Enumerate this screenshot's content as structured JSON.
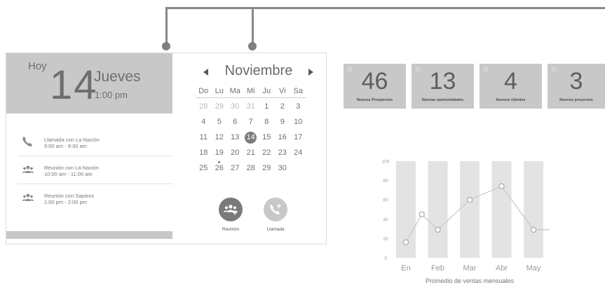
{
  "today": {
    "label": "Hoy",
    "day_number": "14",
    "weekday": "Jueves",
    "time": "1:00 pm"
  },
  "events": [
    {
      "icon": "phone-icon",
      "title": "Llamada con La Nación",
      "time": "9:00 am - 9:30 am"
    },
    {
      "icon": "people-icon",
      "title": "Reunión con La Nación",
      "time": "10:00 am - 11:00 am"
    },
    {
      "icon": "people-icon",
      "title": "Reunión con Sapiens",
      "time": "1:00 pm - 2:00 pm"
    }
  ],
  "calendar": {
    "month": "Noviembre",
    "weekdays": [
      "Do",
      "Lu",
      "Ma",
      "Mi",
      "Ju",
      "Vi",
      "Sa"
    ],
    "days": [
      {
        "d": "28",
        "other": true
      },
      {
        "d": "29",
        "other": true
      },
      {
        "d": "30",
        "other": true
      },
      {
        "d": "31",
        "other": true
      },
      {
        "d": "1"
      },
      {
        "d": "2"
      },
      {
        "d": "3"
      },
      {
        "d": "4"
      },
      {
        "d": "5"
      },
      {
        "d": "6"
      },
      {
        "d": "7"
      },
      {
        "d": "8"
      },
      {
        "d": "9"
      },
      {
        "d": "10"
      },
      {
        "d": "11"
      },
      {
        "d": "12"
      },
      {
        "d": "13"
      },
      {
        "d": "14",
        "selected": true
      },
      {
        "d": "15"
      },
      {
        "d": "16"
      },
      {
        "d": "17"
      },
      {
        "d": "18"
      },
      {
        "d": "19",
        "marked": true
      },
      {
        "d": "20"
      },
      {
        "d": "21"
      },
      {
        "d": "22"
      },
      {
        "d": "23"
      },
      {
        "d": "24"
      },
      {
        "d": "25"
      },
      {
        "d": "26"
      },
      {
        "d": "27"
      },
      {
        "d": "28"
      },
      {
        "d": "29"
      },
      {
        "d": "30"
      }
    ]
  },
  "actions": {
    "meeting_label": "Reunión",
    "call_label": "Llamada"
  },
  "stats": [
    {
      "value": "46",
      "caption": "Nuevos Prospectos"
    },
    {
      "value": "13",
      "caption": "Nuevas oportunidades"
    },
    {
      "value": "4",
      "caption": "Nuevos clientes"
    },
    {
      "value": "3",
      "caption": "Nuevos proyectos"
    }
  ],
  "colors": {
    "panel_gray": "#c8c8c8",
    "selected_day": "#7a7a7a",
    "meeting_button": "#7a7a7a",
    "call_button": "#c8c8c8"
  },
  "chart_data": {
    "type": "line",
    "title": "Promedio de ventas mensuales",
    "categories": [
      "En",
      "Feb",
      "Mar",
      "Abr",
      "May"
    ],
    "yticks": [
      0,
      20,
      40,
      60,
      80,
      100
    ],
    "ylim": [
      0,
      100
    ],
    "x": [
      0,
      0.5,
      1,
      2,
      3,
      4,
      4.5
    ],
    "values": [
      16,
      45,
      29,
      60,
      74,
      29,
      29
    ],
    "bars": true,
    "grid": false
  }
}
